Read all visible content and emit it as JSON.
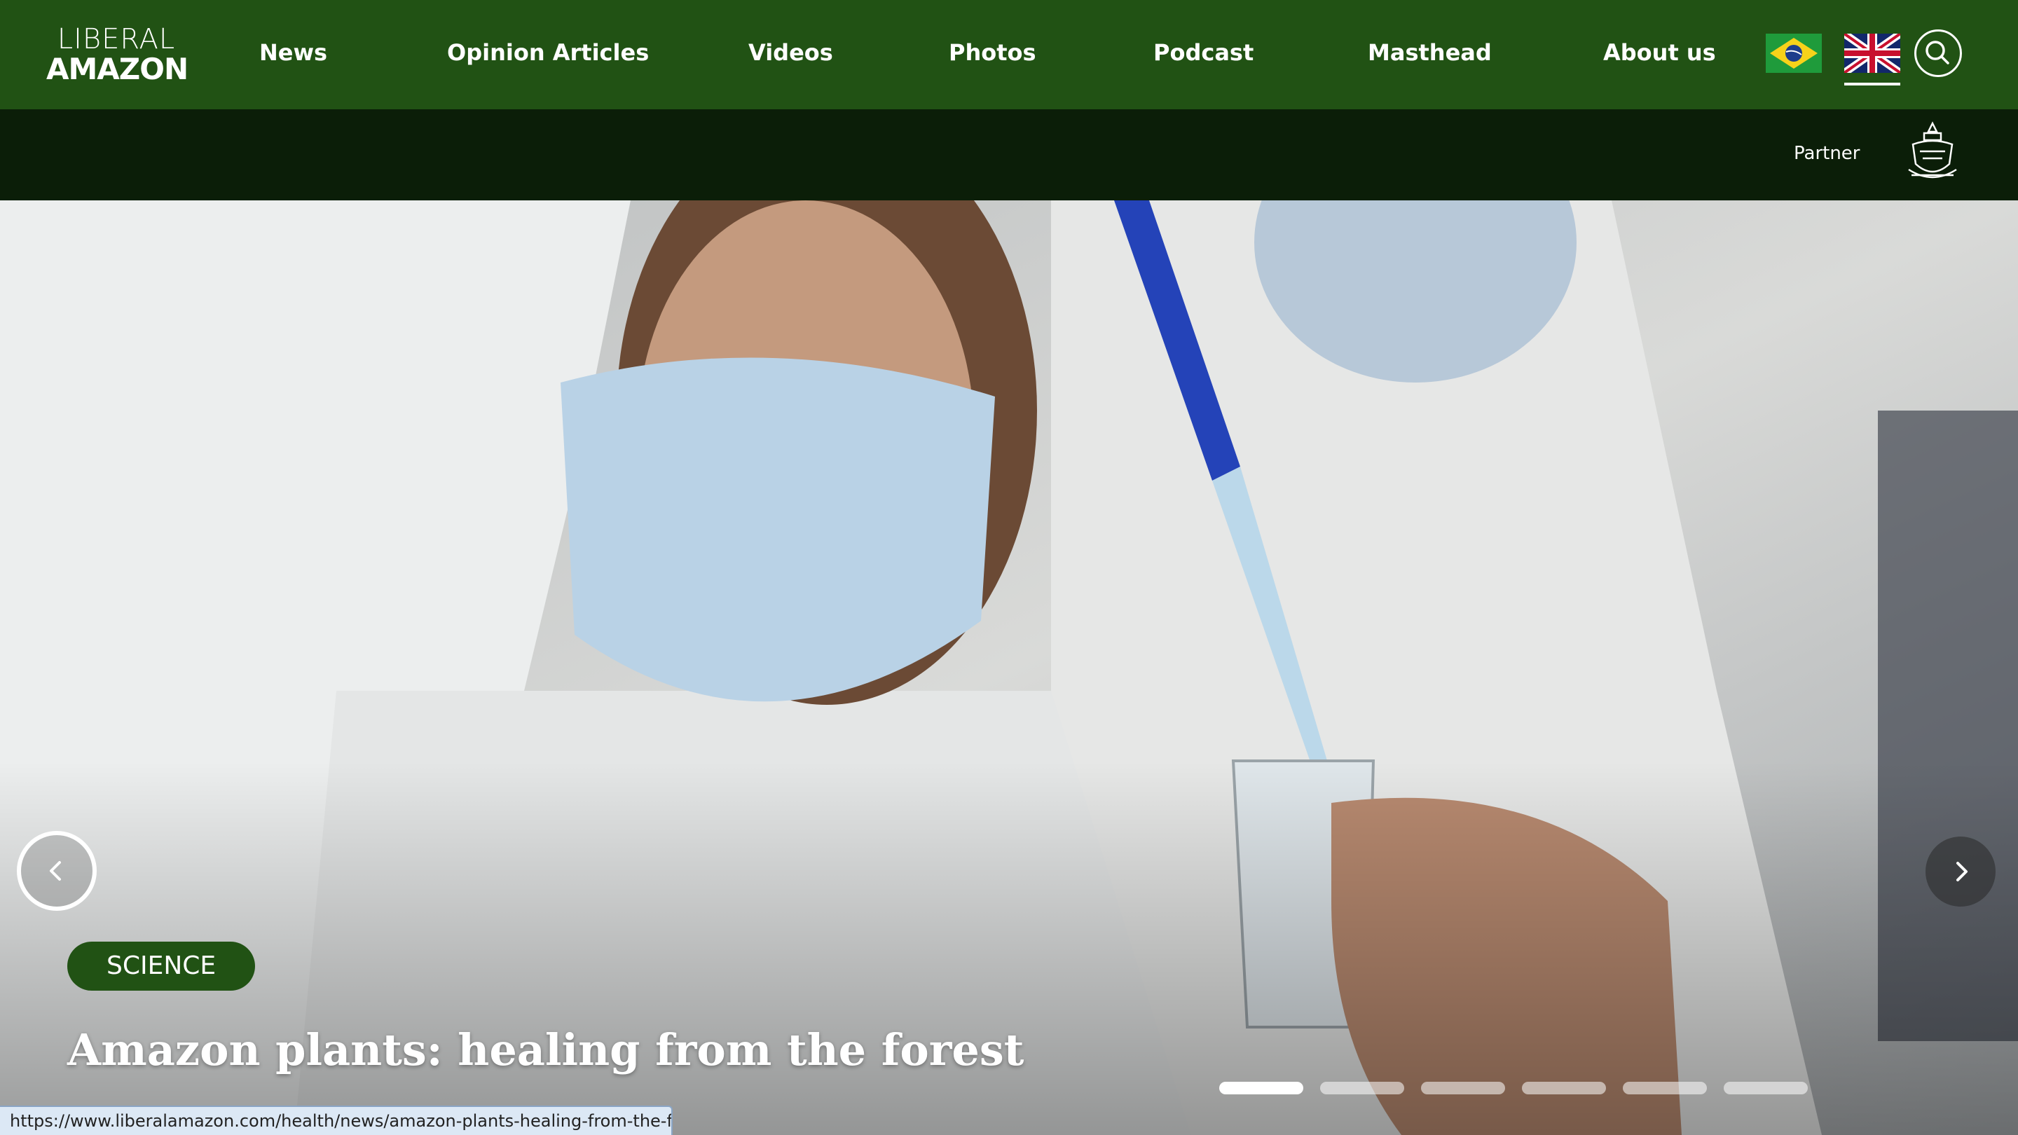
{
  "logo": {
    "line1": "LIBERAL",
    "line2": "AMAZON"
  },
  "nav": {
    "items": [
      {
        "label": "News"
      },
      {
        "label": "Opinion Articles"
      },
      {
        "label": "Videos"
      },
      {
        "label": "Photos"
      },
      {
        "label": "Podcast"
      },
      {
        "label": "Masthead"
      },
      {
        "label": "About us"
      }
    ]
  },
  "language": {
    "options": [
      "brazil-flag-icon",
      "uk-flag-icon"
    ],
    "selected": "uk-flag-icon"
  },
  "search": {
    "icon": "search-icon"
  },
  "partner": {
    "label": "Partner",
    "emblem": "university-emblem-icon"
  },
  "hero": {
    "category": "SCIENCE",
    "headline": "Amazon plants: healing from the forest",
    "slide_count": 6,
    "active_slide": 1
  },
  "status_bar": {
    "url": "https://www.liberalamazon.com/health/news/amazon-plants-healing-from-the-fo..."
  },
  "colors": {
    "nav_green": "#215214",
    "partner_dark": "#0b1e08",
    "badge_green": "#215214"
  }
}
